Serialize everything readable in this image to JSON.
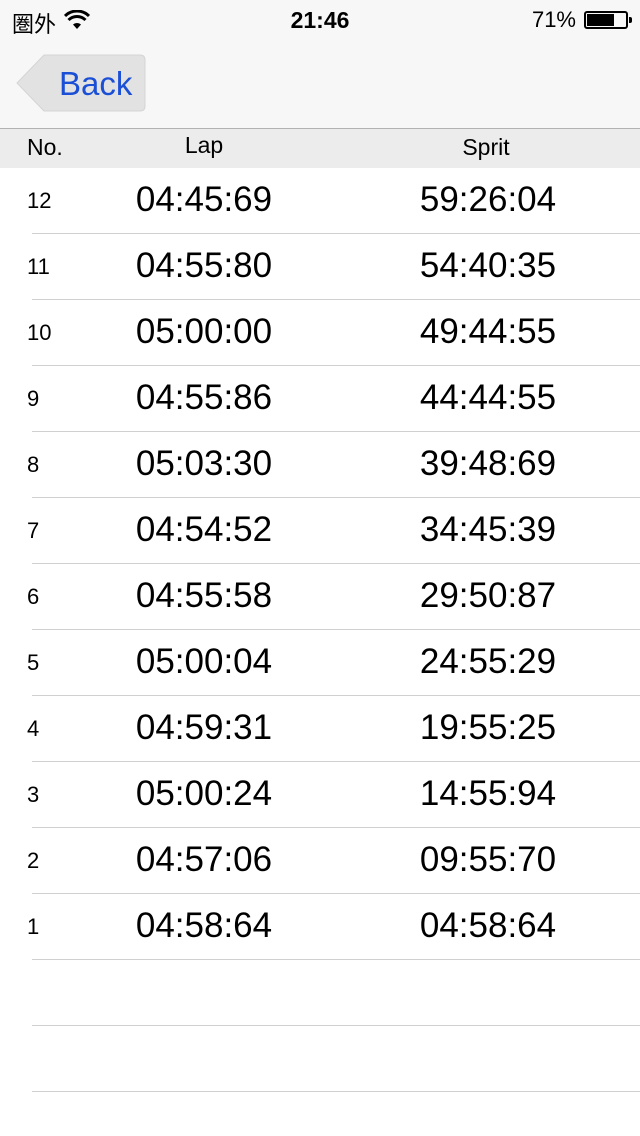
{
  "status_bar": {
    "carrier": "圏外",
    "time": "21:46",
    "battery_percent": "71%",
    "battery_level": 0.71,
    "icons": [
      "wifi-icon",
      "battery-icon"
    ]
  },
  "nav": {
    "back_label": "Back",
    "accent_color": "#1a4fd6"
  },
  "table": {
    "headers": {
      "no": "No.",
      "lap": "Lap",
      "sprit": "Sprit"
    },
    "rows": [
      {
        "no": "12",
        "lap": "04:45:69",
        "sprit": "59:26:04"
      },
      {
        "no": "11",
        "lap": "04:55:80",
        "sprit": "54:40:35"
      },
      {
        "no": "10",
        "lap": "05:00:00",
        "sprit": "49:44:55"
      },
      {
        "no": "9",
        "lap": "04:55:86",
        "sprit": "44:44:55"
      },
      {
        "no": "8",
        "lap": "05:03:30",
        "sprit": "39:48:69"
      },
      {
        "no": "7",
        "lap": "04:54:52",
        "sprit": "34:45:39"
      },
      {
        "no": "6",
        "lap": "04:55:58",
        "sprit": "29:50:87"
      },
      {
        "no": "5",
        "lap": "05:00:04",
        "sprit": "24:55:29"
      },
      {
        "no": "4",
        "lap": "04:59:31",
        "sprit": "19:55:25"
      },
      {
        "no": "3",
        "lap": "05:00:24",
        "sprit": "14:55:94"
      },
      {
        "no": "2",
        "lap": "04:57:06",
        "sprit": "09:55:70"
      },
      {
        "no": "1",
        "lap": "04:58:64",
        "sprit": "04:58:64"
      },
      {
        "no": "",
        "lap": "",
        "sprit": ""
      },
      {
        "no": "",
        "lap": "",
        "sprit": ""
      }
    ]
  }
}
